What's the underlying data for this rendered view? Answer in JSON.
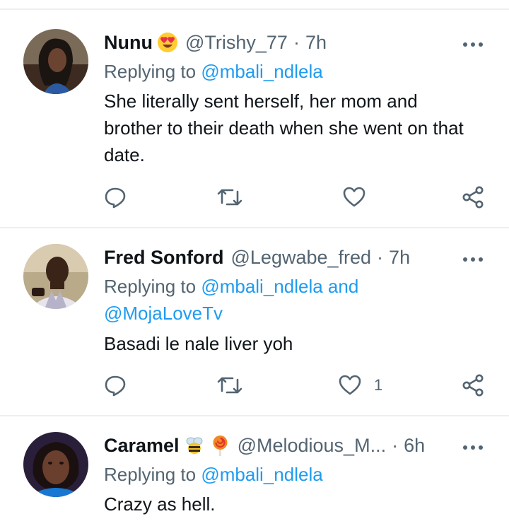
{
  "tweets": [
    {
      "name": "Nunu",
      "handle": "@Trishy_77",
      "dot": "·",
      "time": "7h",
      "emojis": [
        "heart-eyes"
      ],
      "reply_prefix": "Replying to",
      "reply_mentions": "@mbali_ndlela",
      "reply_line2": "",
      "text": "She literally sent herself, her mom and brother to their death when she went on that date.",
      "like_count": ""
    },
    {
      "name": "Fred Sonford",
      "handle": "@Legwabe_fred",
      "dot": "·",
      "time": "7h",
      "emojis": [],
      "reply_prefix": "Replying to",
      "reply_mentions": "@mbali_ndlela and",
      "reply_line2": "@MojaLoveTv",
      "text": "Basadi le nale liver yoh",
      "like_count": "1"
    },
    {
      "name": "Caramel",
      "handle": "@Melodious_M...",
      "dot": "·",
      "time": "6h",
      "emojis": [
        "bee",
        "lollipop"
      ],
      "reply_prefix": "Replying to",
      "reply_mentions": "@mbali_ndlela",
      "reply_line2": "",
      "text": "Crazy as hell.",
      "like_count": ""
    }
  ],
  "colors": {
    "mention": "#1d9bf0",
    "secondary": "#536471",
    "divider": "#eceff1"
  },
  "icons": [
    "more-icon",
    "reply-icon",
    "retweet-icon",
    "like-icon",
    "share-icon"
  ]
}
